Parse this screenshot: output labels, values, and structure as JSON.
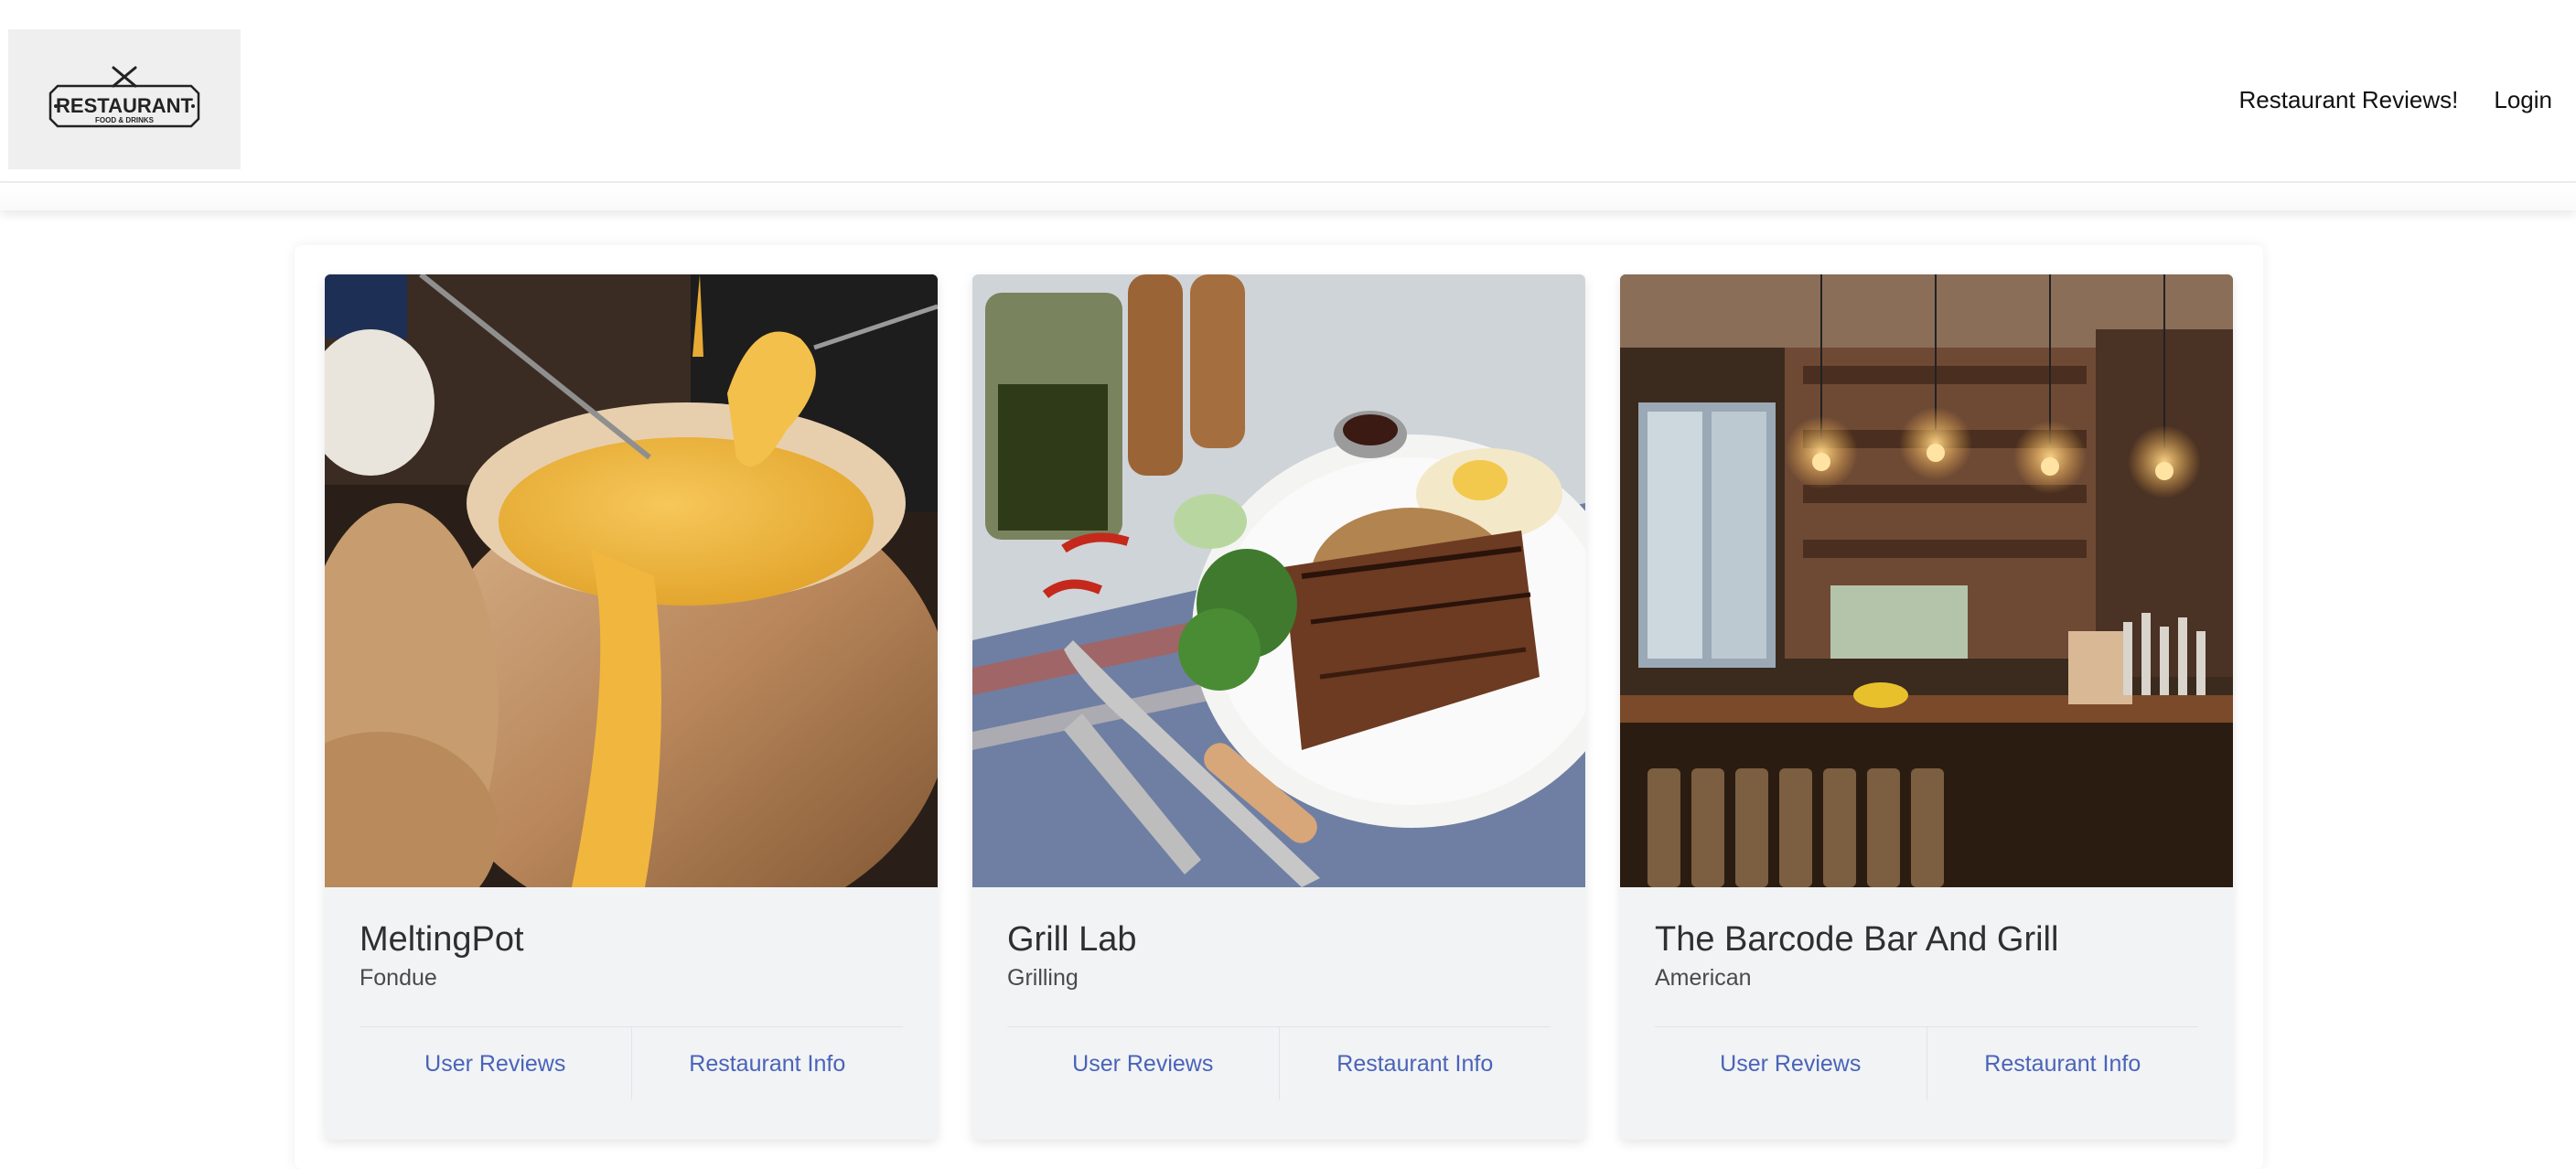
{
  "logo": {
    "title": "RESTAURANT",
    "tagline": "FOOD & DRINKS"
  },
  "nav": {
    "reviews_label": "Restaurant Reviews!",
    "login_label": "Login"
  },
  "restaurants": [
    {
      "name": "MeltingPot",
      "cuisine": "Fondue",
      "reviews_label": "User Reviews",
      "info_label": "Restaurant Info"
    },
    {
      "name": "Grill Lab",
      "cuisine": "Grilling",
      "reviews_label": "User Reviews",
      "info_label": "Restaurant Info"
    },
    {
      "name": "The Barcode Bar And Grill",
      "cuisine": "American",
      "reviews_label": "User Reviews",
      "info_label": "Restaurant Info"
    }
  ],
  "colors": {
    "link": "#4a63b8",
    "card_bg": "#f1f3f5"
  }
}
